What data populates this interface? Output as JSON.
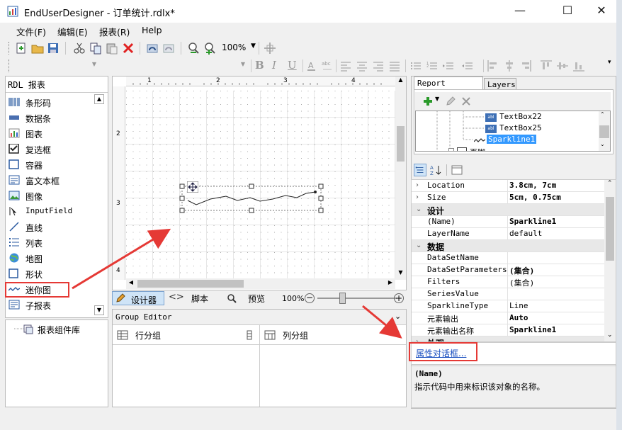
{
  "window": {
    "title": "EndUserDesigner - 订单统计.rdlx*",
    "min_symbol": "—",
    "max_symbol": "☐",
    "close_symbol": "✕"
  },
  "menu": [
    "文件(F)",
    "编辑(E)",
    "报表(R)",
    "Help"
  ],
  "toolbar": {
    "zoom": "100%",
    "icons": [
      "new-report-icon",
      "open-folder-icon",
      "save-icon",
      "cut-icon",
      "copy-icon",
      "paste-icon",
      "delete-icon",
      "undo-icon",
      "redo-icon",
      "zoom-in-icon",
      "zoom-out-icon"
    ]
  },
  "left_panel": {
    "header": "RDL 报表",
    "items": [
      {
        "label": "条形码",
        "icon": "barcode-icon"
      },
      {
        "label": "数据条",
        "icon": "databar-icon"
      },
      {
        "label": "图表",
        "icon": "chart-icon"
      },
      {
        "label": "复选框",
        "icon": "checkbox-icon"
      },
      {
        "label": "容器",
        "icon": "container-icon"
      },
      {
        "label": "富文本框",
        "icon": "richtext-icon"
      },
      {
        "label": "图像",
        "icon": "image-icon"
      },
      {
        "label": "InputField",
        "icon": "inputfield-icon"
      },
      {
        "label": "直线",
        "icon": "line-icon"
      },
      {
        "label": "列表",
        "icon": "list-icon"
      },
      {
        "label": "地图",
        "icon": "map-icon"
      },
      {
        "label": "形状",
        "icon": "shape-icon"
      },
      {
        "label": "迷你图",
        "icon": "sparkline-icon"
      },
      {
        "label": "子报表",
        "icon": "subreport-icon"
      }
    ],
    "library": "报表组件库"
  },
  "designer": {
    "ruler_top": [
      "1",
      "2",
      "3",
      "4"
    ],
    "ruler_left": [
      "2",
      "3",
      "4"
    ],
    "tabs": {
      "designer": "设计器",
      "script": "脚本",
      "preview": "预览"
    },
    "zoom": "100%"
  },
  "group_editor": {
    "title": "Group Editor",
    "row_groups": "行分组",
    "column_groups": "列分组"
  },
  "report_explorer": {
    "tabs": [
      "Report Explorer",
      "Layers"
    ],
    "tree": [
      {
        "label": "TextBox22"
      },
      {
        "label": "TextBox25"
      },
      {
        "label": "Sparkline1",
        "selected": true
      },
      {
        "label": "页脚"
      }
    ]
  },
  "properties": {
    "rows": [
      {
        "type": "prop",
        "expand": "›",
        "name": "Location",
        "value": "3.8cm, 7cm",
        "bold": true
      },
      {
        "type": "prop",
        "expand": "›",
        "name": "Size",
        "value": "5cm, 0.75cm",
        "bold": true
      },
      {
        "type": "cat",
        "expand": "⌄",
        "name": "设计"
      },
      {
        "type": "prop",
        "name": "(Name)",
        "value": "Sparkline1",
        "bold": true
      },
      {
        "type": "prop",
        "name": "LayerName",
        "value": "default"
      },
      {
        "type": "cat",
        "expand": "⌄",
        "name": "数据"
      },
      {
        "type": "prop",
        "name": "DataSetName",
        "value": ""
      },
      {
        "type": "prop",
        "name": "DataSetParameters",
        "value": "(集合)",
        "bold": true
      },
      {
        "type": "prop",
        "name": "Filters",
        "value": "(集合)"
      },
      {
        "type": "prop",
        "name": "SeriesValue",
        "value": ""
      },
      {
        "type": "prop",
        "name": "SparklineType",
        "value": "Line"
      },
      {
        "type": "prop",
        "name": "元素输出",
        "value": "Auto",
        "bold": true
      },
      {
        "type": "prop",
        "name": "元素输出名称",
        "value": "Sparkline1",
        "bold": true
      },
      {
        "type": "cat",
        "expand": "›",
        "name": "外观"
      }
    ],
    "link": "属性对话框...",
    "desc_title": "(Name)",
    "desc_text": "指示代码中用来标识该对象的名称。"
  },
  "accent_red": "#e53935",
  "selection_blue": "#3399ff"
}
